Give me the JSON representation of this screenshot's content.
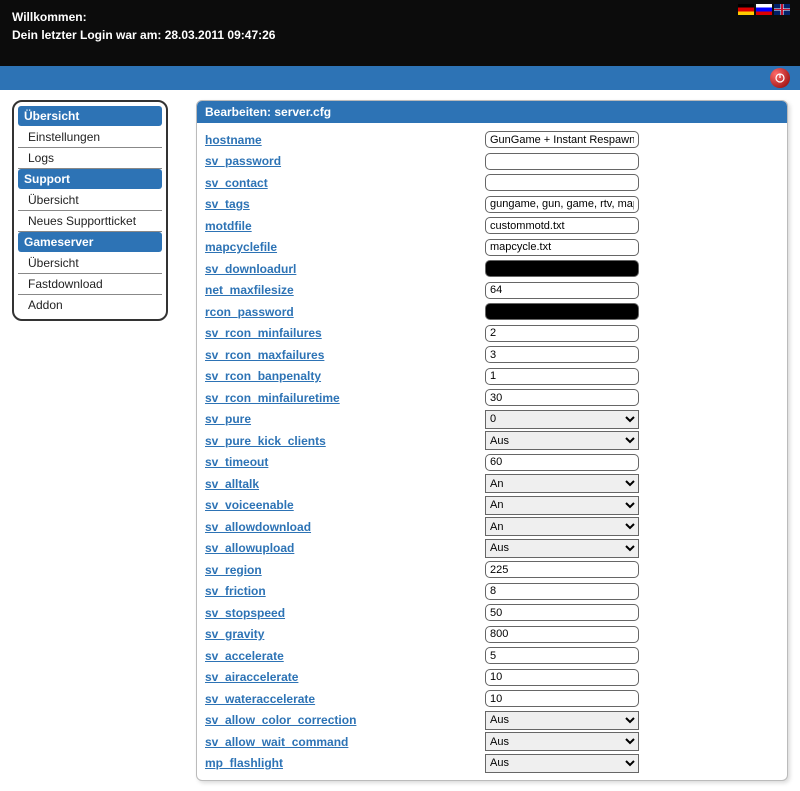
{
  "header": {
    "welcome": "Willkommen:",
    "last_login": "Dein letzter Login war am: 28.03.2011 09:47:26"
  },
  "sidebar": {
    "sections": [
      {
        "header": "Übersicht",
        "items": [
          "Einstellungen",
          "Logs"
        ]
      },
      {
        "header": "Support",
        "items": [
          "Übersicht",
          "Neues Supportticket"
        ]
      },
      {
        "header": "Gameserver",
        "items": [
          "Übersicht",
          "Fastdownload",
          "Addon"
        ]
      }
    ]
  },
  "main": {
    "title": "Bearbeiten: server.cfg",
    "options": {
      "aus": "Aus",
      "an": "An"
    },
    "fields": [
      {
        "key": "hostname",
        "label": "hostname",
        "type": "text",
        "value": "GunGame + Instant Respawn @ t"
      },
      {
        "key": "sv_password",
        "label": "sv_password",
        "type": "text",
        "value": ""
      },
      {
        "key": "sv_contact",
        "label": "sv_contact",
        "type": "text",
        "value": ""
      },
      {
        "key": "sv_tags",
        "label": "sv_tags",
        "type": "text",
        "value": "gungame, gun, game, rtv, mapvot"
      },
      {
        "key": "motdfile",
        "label": "motdfile",
        "type": "text",
        "value": "custommotd.txt"
      },
      {
        "key": "mapcyclefile",
        "label": "mapcyclefile",
        "type": "text",
        "value": "mapcycle.txt"
      },
      {
        "key": "sv_downloadurl",
        "label": "sv_downloadurl",
        "type": "password",
        "value": "xxxxxxxxxxxxxxxxxxxx"
      },
      {
        "key": "net_maxfilesize",
        "label": "net_maxfilesize",
        "type": "text",
        "value": "64"
      },
      {
        "key": "rcon_password",
        "label": "rcon_password",
        "type": "password",
        "value": "xxxxxxxxxxxxxxxxxxxx"
      },
      {
        "key": "sv_rcon_minfailures",
        "label": "sv_rcon_minfailures",
        "type": "text",
        "value": "2"
      },
      {
        "key": "sv_rcon_maxfailures",
        "label": "sv_rcon_maxfailures",
        "type": "text",
        "value": "3"
      },
      {
        "key": "sv_rcon_banpenalty",
        "label": "sv_rcon_banpenalty",
        "type": "text",
        "value": "1"
      },
      {
        "key": "sv_rcon_minfailuretime",
        "label": "sv_rcon_minfailuretime",
        "type": "text",
        "value": "30"
      },
      {
        "key": "sv_pure",
        "label": "sv_pure",
        "type": "select",
        "value": "0"
      },
      {
        "key": "sv_pure_kick_clients",
        "label": "sv_pure_kick_clients",
        "type": "select",
        "value": "Aus"
      },
      {
        "key": "sv_timeout",
        "label": "sv_timeout",
        "type": "text",
        "value": "60"
      },
      {
        "key": "sv_alltalk",
        "label": "sv_alltalk",
        "type": "select",
        "value": "An"
      },
      {
        "key": "sv_voiceenable",
        "label": "sv_voiceenable",
        "type": "select",
        "value": "An"
      },
      {
        "key": "sv_allowdownload",
        "label": "sv_allowdownload",
        "type": "select",
        "value": "An"
      },
      {
        "key": "sv_allowupload",
        "label": "sv_allowupload",
        "type": "select",
        "value": "Aus"
      },
      {
        "key": "sv_region",
        "label": "sv_region",
        "type": "text",
        "value": "225"
      },
      {
        "key": "sv_friction",
        "label": "sv_friction",
        "type": "text",
        "value": "8"
      },
      {
        "key": "sv_stopspeed",
        "label": "sv_stopspeed",
        "type": "text",
        "value": "50"
      },
      {
        "key": "sv_gravity",
        "label": "sv_gravity",
        "type": "text",
        "value": "800"
      },
      {
        "key": "sv_accelerate",
        "label": "sv_accelerate",
        "type": "text",
        "value": "5"
      },
      {
        "key": "sv_airaccelerate",
        "label": "sv_airaccelerate",
        "type": "text",
        "value": "10"
      },
      {
        "key": "sv_wateraccelerate",
        "label": "sv_wateraccelerate",
        "type": "text",
        "value": "10"
      },
      {
        "key": "sv_allow_color_correction",
        "label": "sv_allow_color_correction",
        "type": "select",
        "value": "Aus"
      },
      {
        "key": "sv_allow_wait_command",
        "label": "sv_allow_wait_command",
        "type": "select",
        "value": "Aus"
      },
      {
        "key": "mp_flashlight",
        "label": "mp_flashlight",
        "type": "select",
        "value": "Aus"
      }
    ]
  }
}
